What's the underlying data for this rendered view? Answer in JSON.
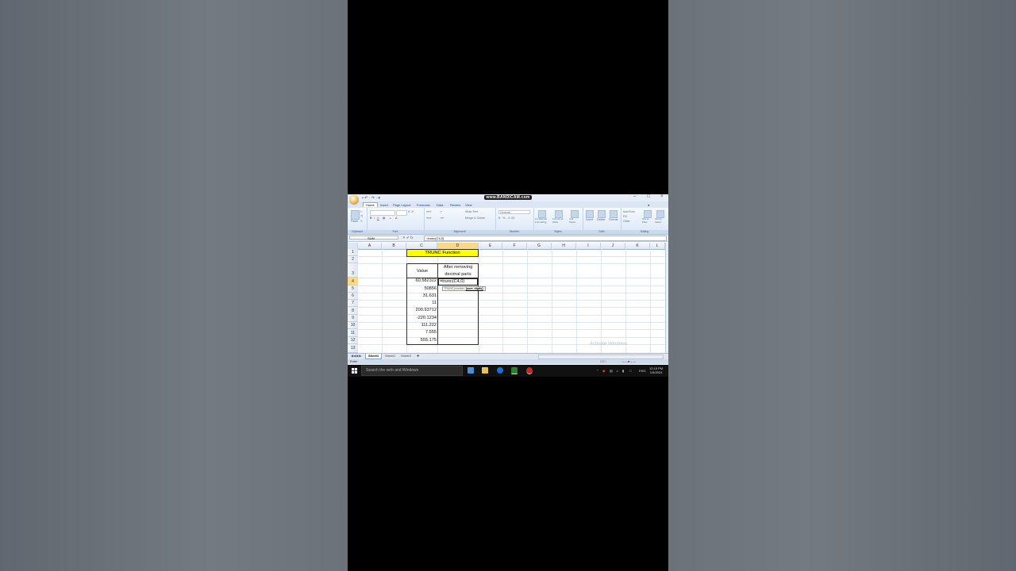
{
  "window": {
    "title": "www.BANDICAM.com",
    "qat": "▪ ↶ · ↷ · ▾"
  },
  "ribbon": {
    "tabs": [
      "Home",
      "Insert",
      "Page Layout",
      "Formulas",
      "Data",
      "Review",
      "View"
    ],
    "active_tab": "Home",
    "groups": {
      "clipboard": {
        "label": "Clipboard",
        "paste": "Paste"
      },
      "font": {
        "label": "Font"
      },
      "alignment": {
        "label": "Alignment",
        "wrap": "Wrap Text",
        "merge": "Merge & Center"
      },
      "number": {
        "label": "Number",
        "format": "General"
      },
      "styles": {
        "label": "Styles",
        "cond": "Conditional Formatting",
        "table": "Format as Table",
        "cell": "Cell Styles"
      },
      "cells": {
        "label": "Cells",
        "insert": "Insert",
        "delete": "Delete",
        "format": "Format"
      },
      "editing": {
        "label": "Editing",
        "autosum": "AutoSum",
        "fill": "Fill",
        "clear": "Clear",
        "sort": "Sort & Filter",
        "find": "Find & Select"
      }
    }
  },
  "formula_bar": {
    "name_box": "SUM",
    "icons": "✕ ✔ fx",
    "formula": "=trunc(C4,0)"
  },
  "grid": {
    "columns": [
      "A",
      "B",
      "C",
      "D",
      "E",
      "F",
      "G",
      "H",
      "I",
      "J",
      "K",
      "L"
    ],
    "rows": [
      "1",
      "2",
      "3",
      "4",
      "5",
      "6",
      "7",
      "8",
      "9",
      "10",
      "11",
      "12",
      "13"
    ],
    "title": "TRUNC Function",
    "header_value": "Value",
    "header_result_line1": "After removing",
    "header_result_line2": "decimal parts",
    "values": [
      "60.582322",
      "50856",
      "31.631",
      "11",
      "200.93712",
      "-220.1234",
      "111.222",
      "7.555",
      "555.175"
    ],
    "editing_cell": "=trunc(C4,0)",
    "tooltip": {
      "prefix": "TRUNC(number, ",
      "bold": "[num_digits]",
      "suffix": ")"
    }
  },
  "watermark": "Activate Windows",
  "sheets": [
    "Sheet1",
    "Sheet2",
    "Sheet3"
  ],
  "status": "Enter",
  "taskbar": {
    "search_placeholder": "Search the web and Windows",
    "language": "ENG",
    "time": "12:15 PM",
    "date": "1/5/2024"
  }
}
